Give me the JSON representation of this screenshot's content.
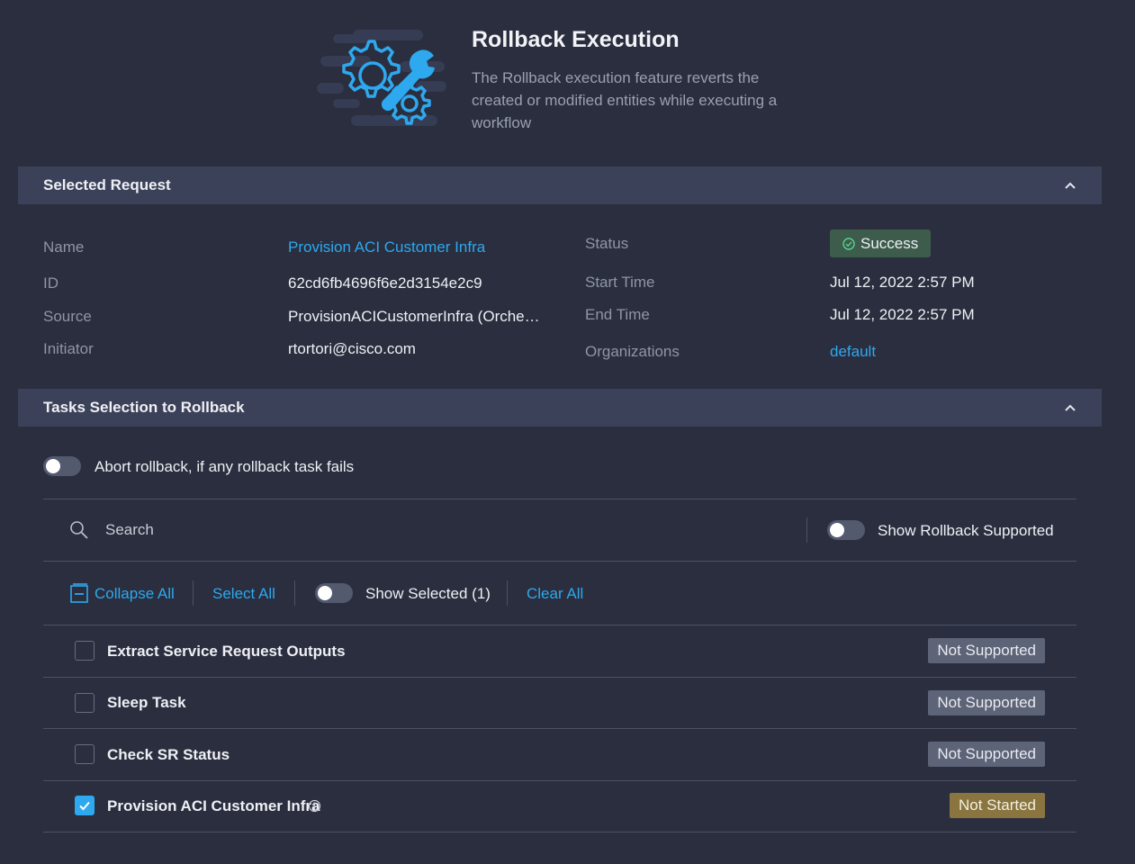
{
  "header": {
    "title": "Rollback Execution",
    "description": "The Rollback execution feature reverts the created or modified entities while executing a workflow"
  },
  "selected_request": {
    "section_title": "Selected Request",
    "name_label": "Name",
    "name_value": "Provision ACI Customer Infra",
    "id_label": "ID",
    "id_value": "62cd6fb4696f6e2d3154e2c9",
    "source_label": "Source",
    "source_value": "ProvisionACICustomerInfra (Orche…",
    "initiator_label": "Initiator",
    "initiator_value": "rtortori@cisco.com",
    "status_label": "Status",
    "status_value": "Success",
    "start_label": "Start Time",
    "start_value": "Jul 12, 2022 2:57 PM",
    "end_label": "End Time",
    "end_value": "Jul 12, 2022 2:57 PM",
    "orgs_label": "Organizations",
    "orgs_value": "default"
  },
  "tasks": {
    "section_title": "Tasks Selection to Rollback",
    "abort_label": "Abort rollback, if any rollback task fails",
    "search_placeholder": "Search",
    "show_supported_label": "Show Rollback Supported",
    "collapse_all": "Collapse All",
    "select_all": "Select All",
    "show_selected": "Show Selected (1)",
    "clear_all": "Clear All",
    "rows": [
      {
        "label": "Extract Service Request Outputs",
        "status": "Not Supported",
        "checked": false
      },
      {
        "label": "Sleep Task",
        "status": "Not Supported",
        "checked": false
      },
      {
        "label": "Check SR Status",
        "status": "Not Supported",
        "checked": false
      },
      {
        "label": "Provision ACI Customer Infra",
        "status": "Not Started",
        "checked": true
      }
    ]
  },
  "colors": {
    "background": "#2a2e3e",
    "section_header": "#3b4158",
    "accent": "#2ea8ee",
    "success_badge": "#3d5c4c",
    "not_supported": "#5e6478",
    "not_started": "#8a7540"
  },
  "icons": [
    "gears-wrench-illustration",
    "chevron-up-icon",
    "check-circle-icon",
    "search-icon",
    "collapse-icon",
    "checkmark-icon",
    "info-icon"
  ]
}
